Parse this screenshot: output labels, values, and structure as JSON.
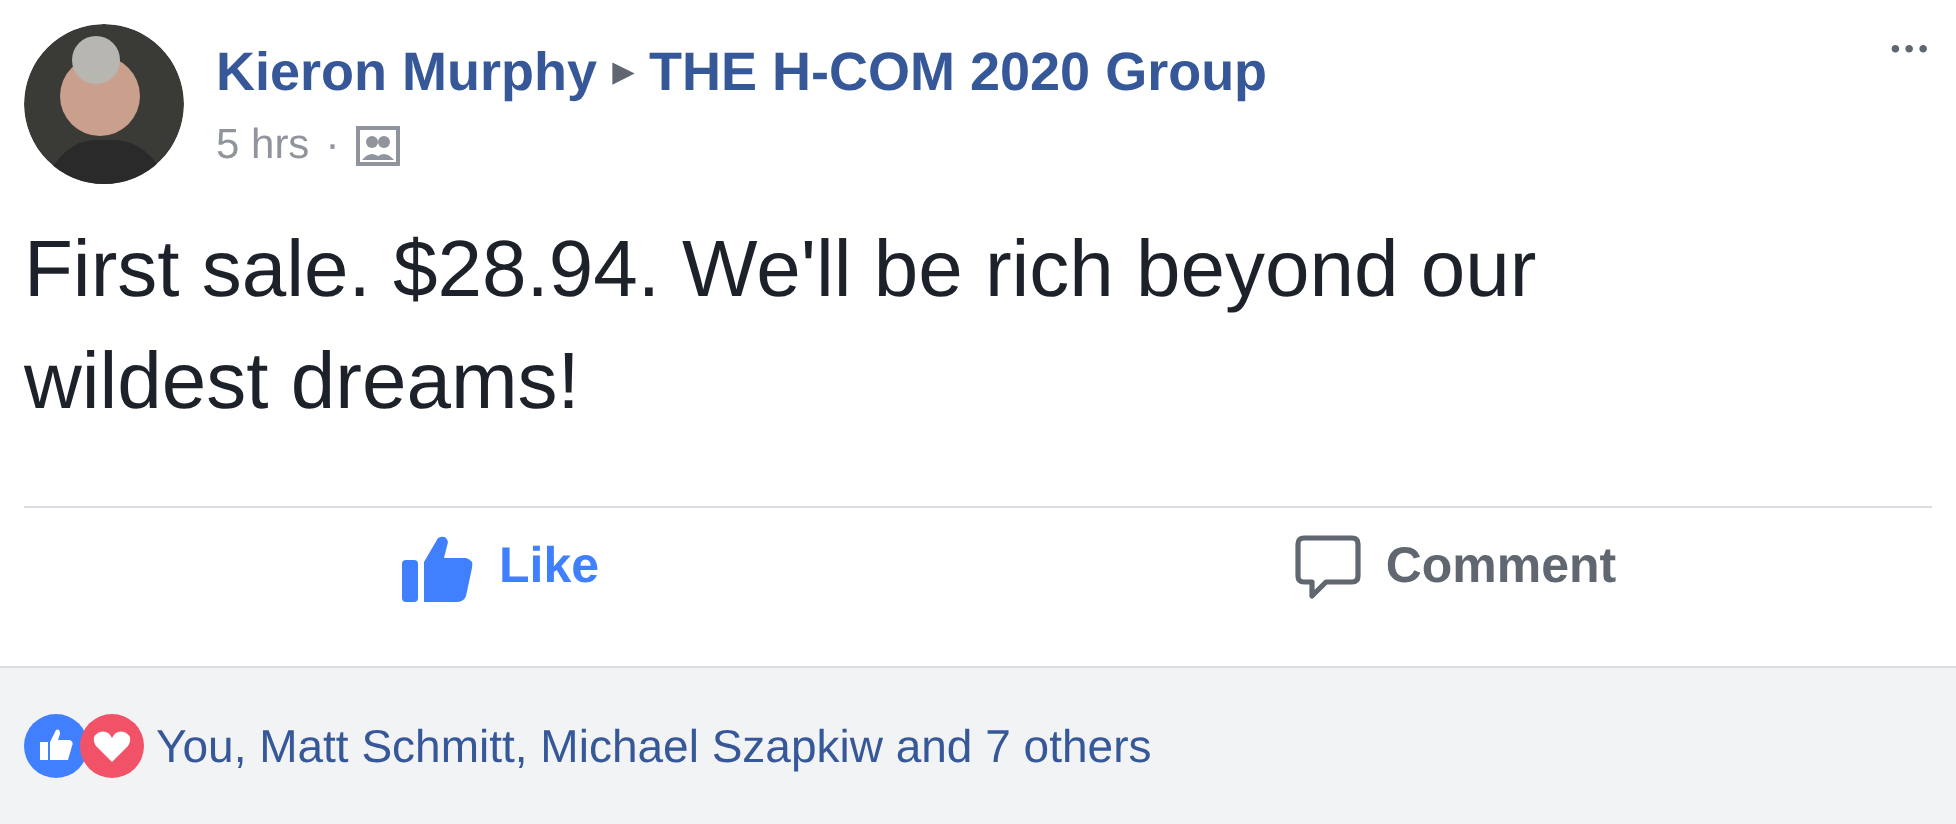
{
  "post": {
    "author": "Kieron Murphy",
    "separator": "▸",
    "group": "THE H-COM 2020 Group",
    "time": "5 hrs",
    "dot": "·",
    "more": "•••",
    "text": "First sale. $28.94. We'll be rich beyond our wildest dreams!"
  },
  "actions": [
    {
      "kind": "like",
      "label": "Like",
      "selected": true
    },
    {
      "kind": "comment",
      "label": "Comment",
      "selected": false
    }
  ],
  "reactions": {
    "summary": "You, Matt Schmitt, Michael Szapkiw and 7 others"
  }
}
